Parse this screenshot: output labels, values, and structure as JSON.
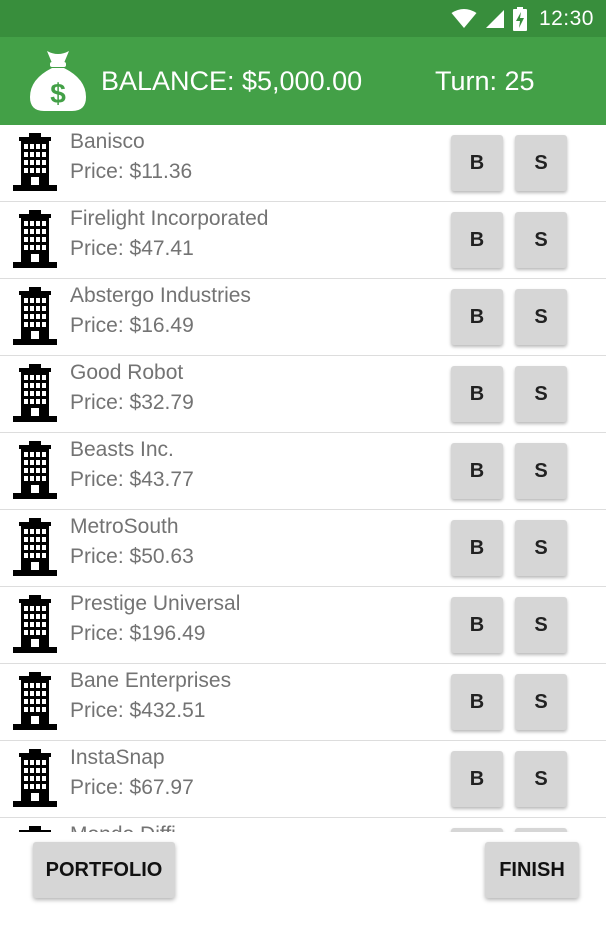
{
  "status_bar": {
    "time": "12:30",
    "icons": [
      "wifi-icon",
      "cell-signal-icon",
      "battery-charging-icon"
    ]
  },
  "header": {
    "balance_label": "BALANCE:",
    "balance_value": "$5,000.00",
    "turn": "Turn: 25",
    "icon": "money-bag-icon",
    "accent": "#43a047",
    "status_bar_color": "#388e3c"
  },
  "stocks": [
    {
      "name": "Banisco",
      "price": "Price: $11.36",
      "buy_label": "B",
      "sell_label": "S"
    },
    {
      "name": "Firelight Incorporated",
      "price": "Price: $47.41",
      "buy_label": "B",
      "sell_label": "S"
    },
    {
      "name": "Abstergo Industries",
      "price": "Price: $16.49",
      "buy_label": "B",
      "sell_label": "S"
    },
    {
      "name": "Good Robot",
      "price": "Price: $32.79",
      "buy_label": "B",
      "sell_label": "S"
    },
    {
      "name": "Beasts Inc.",
      "price": "Price: $43.77",
      "buy_label": "B",
      "sell_label": "S"
    },
    {
      "name": "MetroSouth",
      "price": "Price: $50.63",
      "buy_label": "B",
      "sell_label": "S"
    },
    {
      "name": "Prestige Universal",
      "price": "Price: $196.49",
      "buy_label": "B",
      "sell_label": "S"
    },
    {
      "name": "Bane Enterprises",
      "price": "Price: $432.51",
      "buy_label": "B",
      "sell_label": "S"
    },
    {
      "name": "InstaSnap",
      "price": "Price: $67.97",
      "buy_label": "B",
      "sell_label": "S"
    },
    {
      "name": "Mondo Diffi",
      "price": "",
      "buy_label": "B",
      "sell_label": "S"
    }
  ],
  "footer": {
    "portfolio_label": "PORTFOLIO",
    "finish_label": "FINISH"
  }
}
